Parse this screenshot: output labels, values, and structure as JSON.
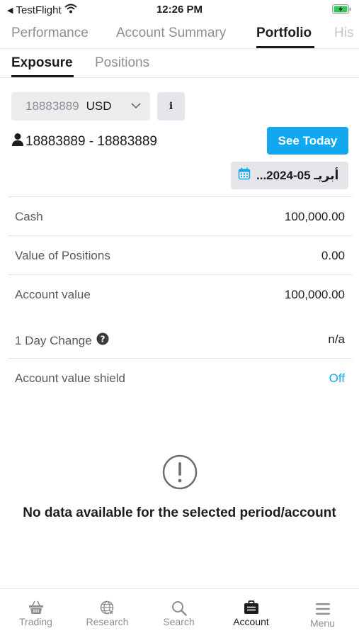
{
  "status_bar": {
    "back_app": "TestFlight",
    "time": "12:26 PM"
  },
  "top_tabs": [
    {
      "label": "Performance"
    },
    {
      "label": "Account Summary"
    },
    {
      "label": "Portfolio",
      "active": true
    },
    {
      "label": "His"
    }
  ],
  "sub_tabs": [
    {
      "label": "Exposure",
      "active": true
    },
    {
      "label": "Positions"
    }
  ],
  "account_select": {
    "account_number": "18883889",
    "currency": "USD"
  },
  "info_button": {
    "label": "i"
  },
  "account_label": "18883889 - 18883889",
  "see_today_label": "See Today",
  "date_picker": {
    "value": "...أبريـ 05-2024"
  },
  "rows": [
    {
      "label": "Cash",
      "value": "100,000.00"
    },
    {
      "label": "Value of Positions",
      "value": "0.00"
    },
    {
      "label": "Account value",
      "value": "100,000.00"
    },
    {
      "label": "1 Day Change",
      "value": "n/a"
    },
    {
      "label": "Account value shield",
      "value": "Off"
    }
  ],
  "empty_state": {
    "message": "No data available for the selected period/account"
  },
  "bottom_nav": [
    {
      "label": "Trading",
      "icon": "basket-icon"
    },
    {
      "label": "Research",
      "icon": "globe-star-icon"
    },
    {
      "label": "Search",
      "icon": "search-icon"
    },
    {
      "label": "Account",
      "icon": "briefcase-icon",
      "active": true
    },
    {
      "label": "Menu",
      "icon": "hamburger-menu-icon"
    }
  ],
  "colors": {
    "accent": "#12a8f0",
    "text": "#1c1c1e",
    "muted": "#8e8e93",
    "battery": "#34c759"
  }
}
